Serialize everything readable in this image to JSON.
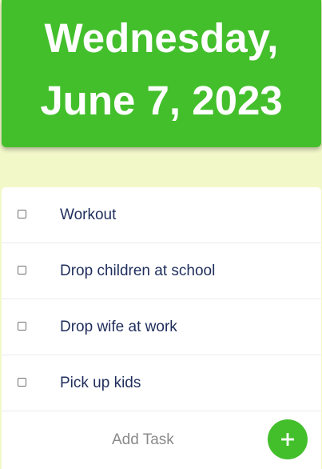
{
  "header": {
    "date_line1": "Wednesday,",
    "date_line2": "June 7, 2023"
  },
  "tasks": [
    {
      "label": "Workout",
      "checked": false
    },
    {
      "label": "Drop children at school",
      "checked": false
    },
    {
      "label": "Drop wife at work",
      "checked": false
    },
    {
      "label": "Pick up kids",
      "checked": false
    }
  ],
  "add_task": {
    "label": "Add Task",
    "button_icon": "plus-icon"
  },
  "colors": {
    "accent": "#43bf2c",
    "background": "#f3f8c9",
    "task_text": "#1f2e5c",
    "placeholder_text": "#8a8a8a"
  }
}
